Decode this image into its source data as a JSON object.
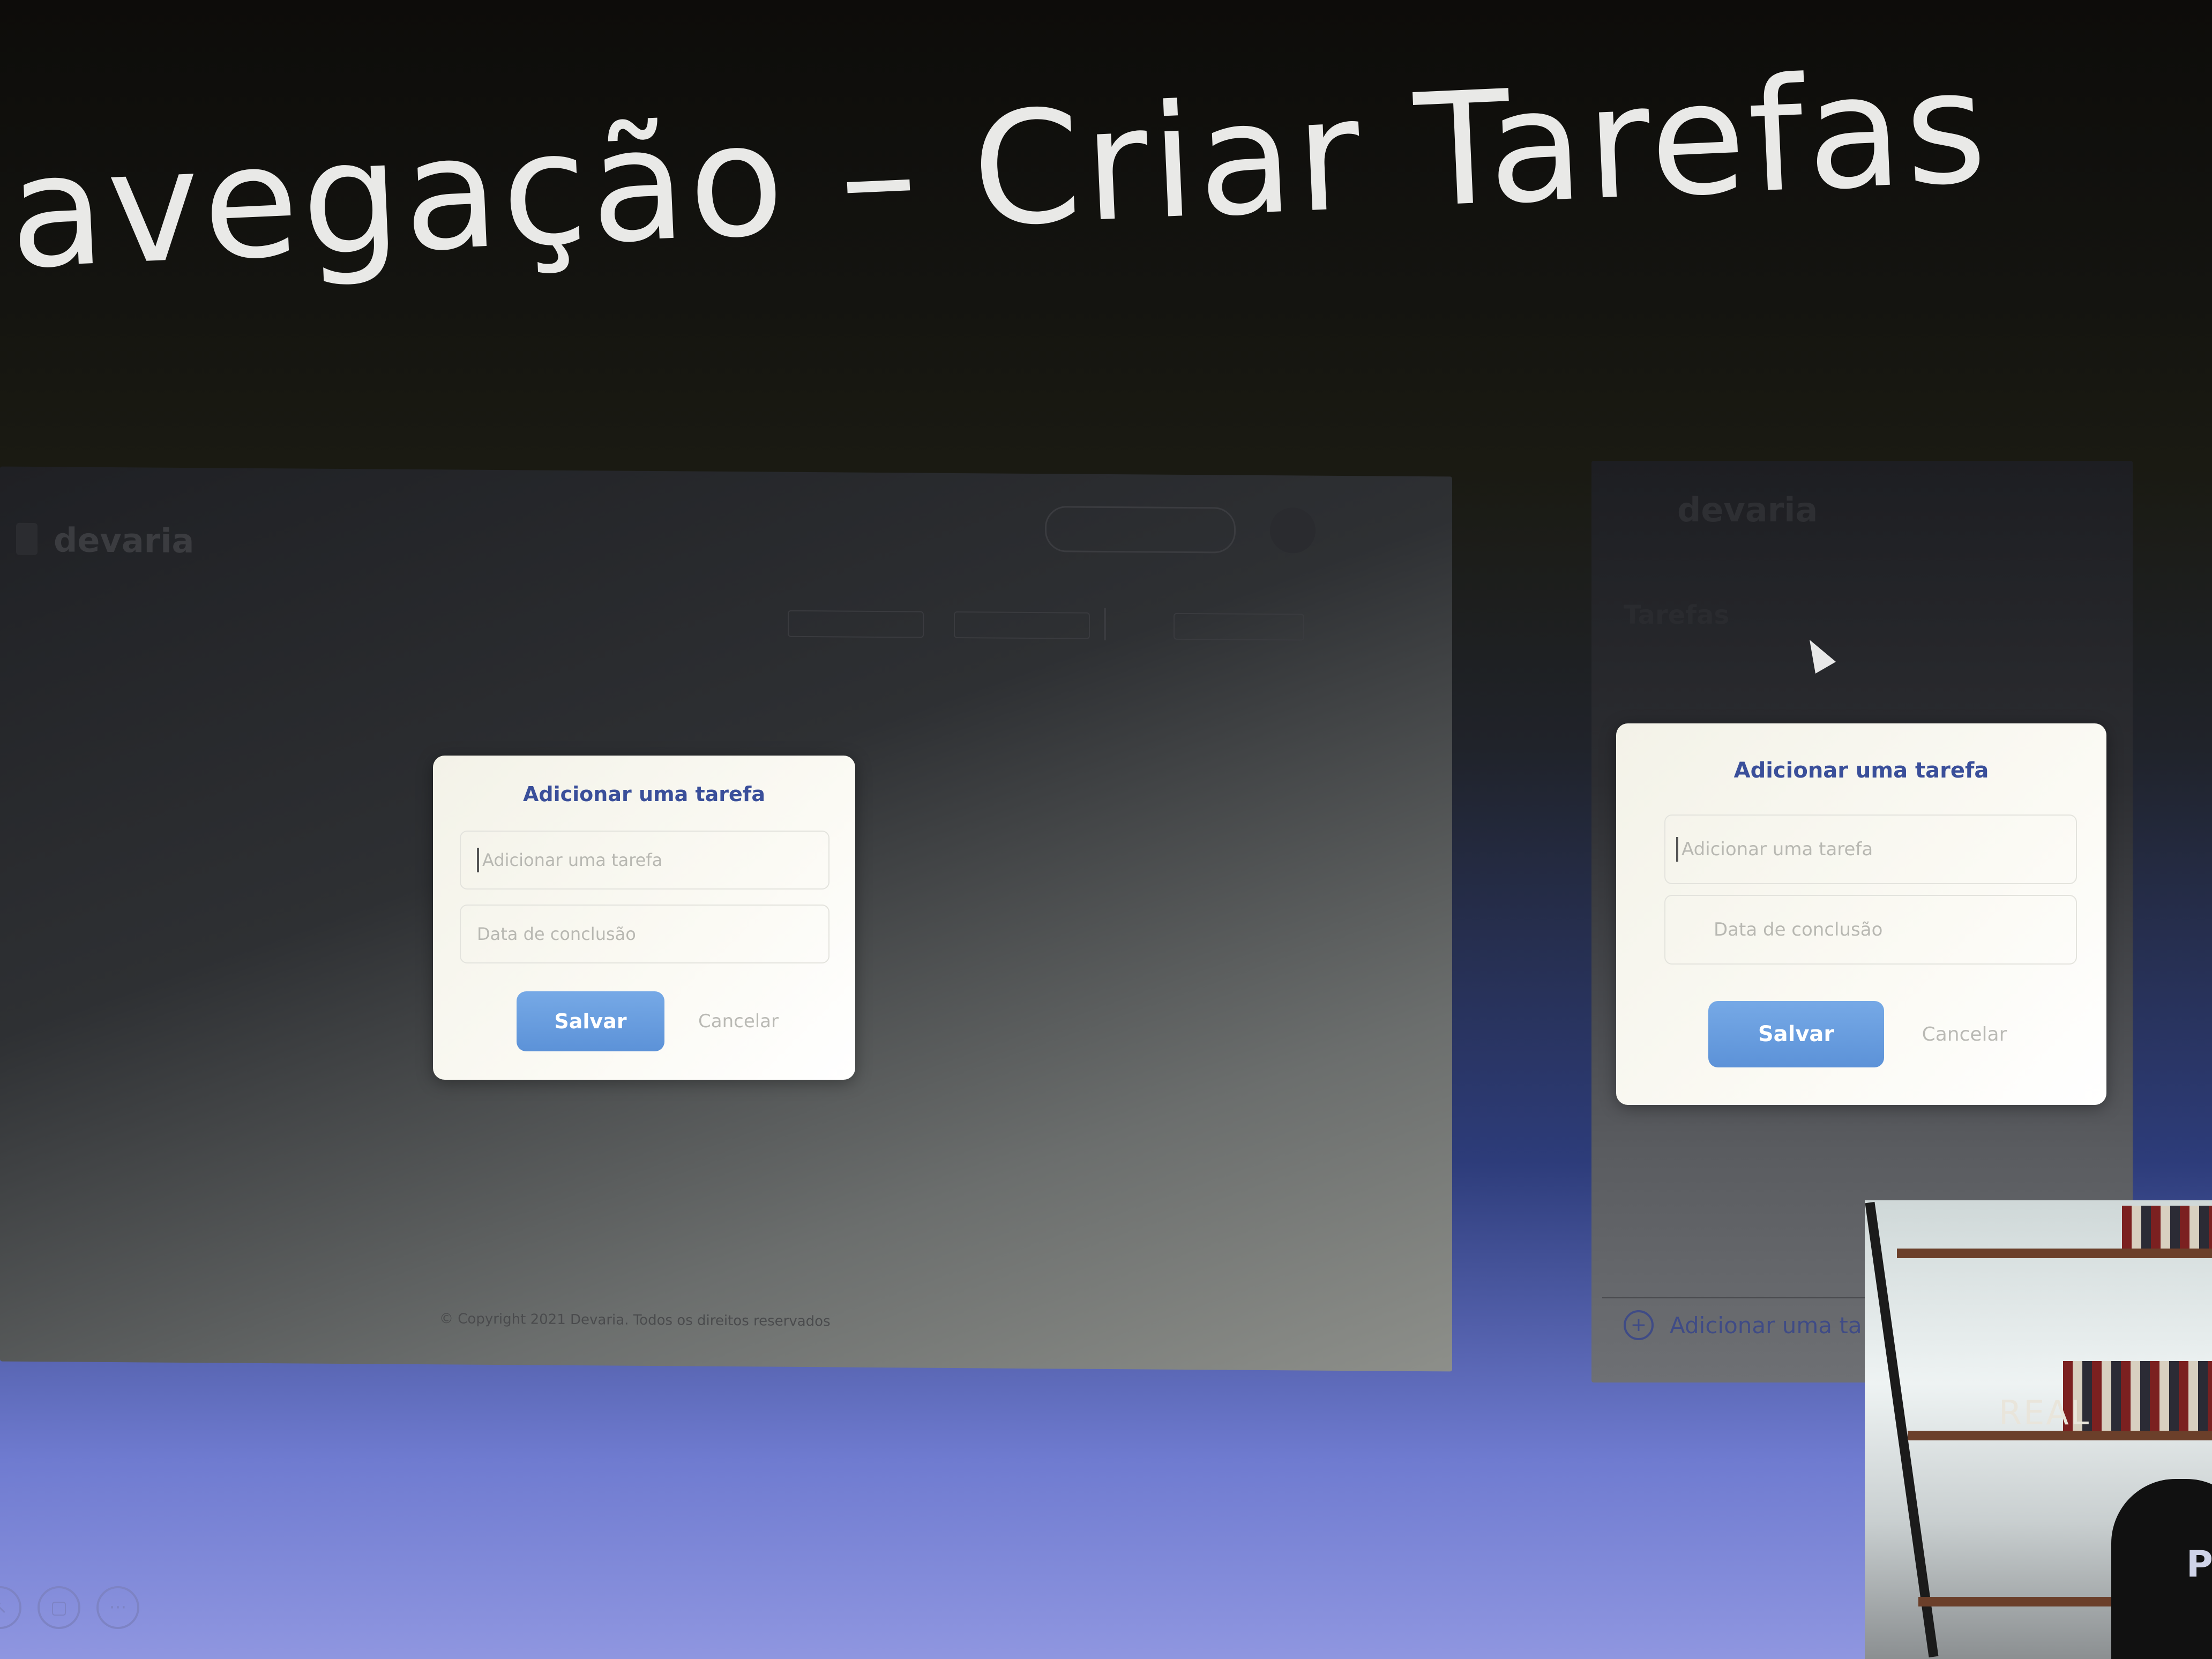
{
  "slide": {
    "title": "avegação – Criar Tarefas"
  },
  "desktop": {
    "logo": "devaria",
    "footer": "© Copyright 2021 Devaria. Todos os direitos reservados",
    "modal": {
      "title": "Adicionar uma tarefa",
      "task_placeholder": "Adicionar uma tarefa",
      "date_placeholder": "Data de conclusão",
      "save_label": "Salvar",
      "cancel_label": "Cancelar"
    }
  },
  "mobile": {
    "logo": "devaria",
    "section_title": "Tarefas",
    "add_label": "Adicionar uma ta",
    "modal": {
      "title": "Adicionar uma tarefa",
      "task_placeholder": "Adicionar uma tarefa",
      "date_placeholder": "Data de conclusão",
      "save_label": "Salvar",
      "cancel_label": "Cancelar"
    }
  },
  "webcam": {
    "sign": "REAL",
    "shirt_text": "P"
  },
  "controls": {
    "more_label": "···"
  },
  "colors": {
    "accent": "#5c92d8",
    "title_blue": "#3a4f9a",
    "slide_bg": "#141410"
  },
  "icons": [
    "plus-circle-icon",
    "cursor-icon",
    "chat-icon",
    "more-icon"
  ]
}
